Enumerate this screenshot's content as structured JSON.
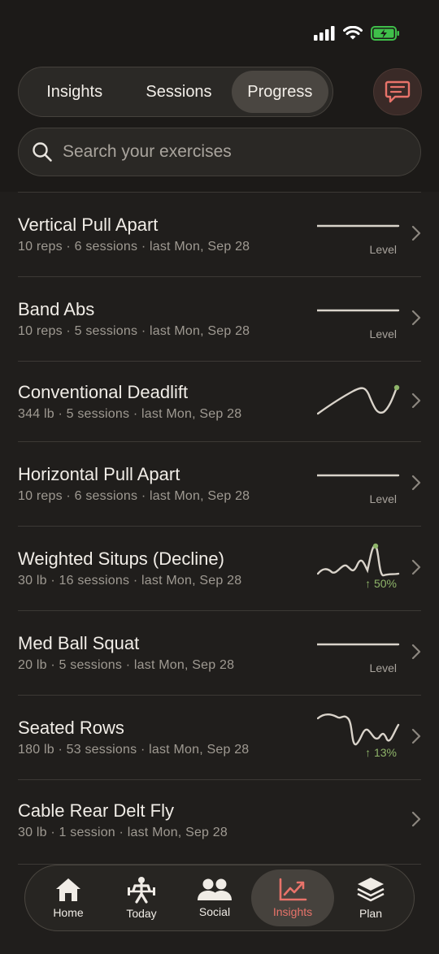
{
  "status": {
    "signal": "signal-icon",
    "wifi": "wifi-icon",
    "battery": "battery-charging-icon",
    "battery_color": "#3fbf4a"
  },
  "segmented": {
    "tabs": [
      "Insights",
      "Sessions",
      "Progress"
    ],
    "selected": "Progress"
  },
  "search": {
    "placeholder": "Search your exercises"
  },
  "exercises": [
    {
      "title": "Vertical Pull Apart",
      "subtitle": "10 reps · 6 sessions · last Mon, Sep 28",
      "trend": "Level"
    },
    {
      "title": "Band Abs",
      "subtitle": "10 reps · 5 sessions · last Mon, Sep 28",
      "trend": "Level"
    },
    {
      "title": "Conventional Deadlift",
      "subtitle": "344 lb · 5 sessions · last Mon, Sep 28",
      "trend": ""
    },
    {
      "title": "Horizontal Pull Apart",
      "subtitle": "10 reps · 6 sessions · last Mon, Sep 28",
      "trend": "Level"
    },
    {
      "title": "Weighted Situps (Decline)",
      "subtitle": "30 lb · 16 sessions · last Mon, Sep 28",
      "trend": "↑ 50%"
    },
    {
      "title": "Med Ball Squat",
      "subtitle": "20 lb · 5 sessions · last Mon, Sep 28",
      "trend": "Level"
    },
    {
      "title": "Seated Rows",
      "subtitle": "180 lb · 53 sessions · last Mon, Sep 28",
      "trend": "↑ 13%"
    },
    {
      "title": "Cable Rear Delt Fly",
      "subtitle": "30 lb · 1 session · last Mon, Sep 28",
      "trend": ""
    }
  ],
  "tabbar": {
    "items": [
      {
        "label": "Home",
        "icon": "home-icon"
      },
      {
        "label": "Today",
        "icon": "weightlifter-icon"
      },
      {
        "label": "Social",
        "icon": "people-icon"
      },
      {
        "label": "Insights",
        "icon": "chart-trend-icon"
      },
      {
        "label": "Plan",
        "icon": "layers-icon"
      }
    ],
    "active": "Insights"
  },
  "colors": {
    "accent": "#e8736a",
    "positive": "#8fb56a",
    "background": "#201e1c"
  }
}
